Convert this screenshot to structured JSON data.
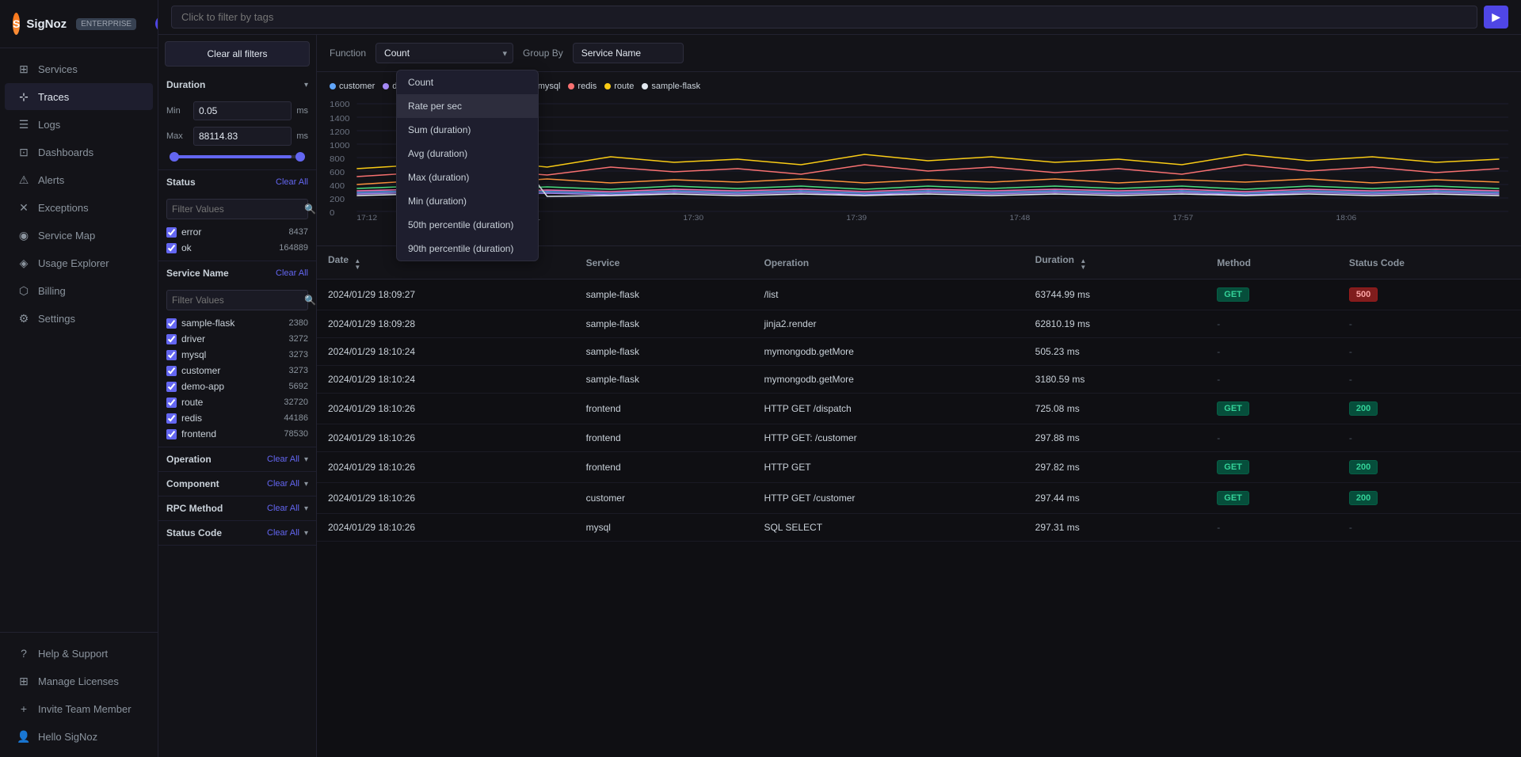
{
  "app": {
    "name": "SigNoz",
    "badge": "ENTERPRISE"
  },
  "topbar": {
    "placeholder": "Click to filter by tags"
  },
  "sidebar": {
    "items": [
      {
        "id": "services",
        "label": "Services",
        "icon": "⊞",
        "active": false
      },
      {
        "id": "traces",
        "label": "Traces",
        "icon": "⊹",
        "active": true
      },
      {
        "id": "logs",
        "label": "Logs",
        "icon": "☰",
        "active": false
      },
      {
        "id": "dashboards",
        "label": "Dashboards",
        "icon": "⊡",
        "active": false
      },
      {
        "id": "alerts",
        "label": "Alerts",
        "icon": "⚠",
        "active": false
      },
      {
        "id": "exceptions",
        "label": "Exceptions",
        "icon": "✕",
        "active": false
      },
      {
        "id": "service-map",
        "label": "Service Map",
        "icon": "◉",
        "active": false
      },
      {
        "id": "usage-explorer",
        "label": "Usage Explorer",
        "icon": "◈",
        "active": false
      },
      {
        "id": "billing",
        "label": "Billing",
        "icon": "⬡",
        "active": false
      },
      {
        "id": "settings",
        "label": "Settings",
        "icon": "⚙",
        "active": false
      }
    ],
    "bottom": [
      {
        "id": "help",
        "label": "Help & Support",
        "icon": "?"
      },
      {
        "id": "manage",
        "label": "Manage Licenses",
        "icon": "⊞"
      },
      {
        "id": "invite",
        "label": "Invite Team Member",
        "icon": "+"
      },
      {
        "id": "hello",
        "label": "Hello SigNoz",
        "icon": "👤"
      }
    ]
  },
  "filters": {
    "clear_all_label": "Clear all filters",
    "duration": {
      "title": "Duration",
      "min_label": "Min",
      "max_label": "Max",
      "min_value": "0.05",
      "max_value": "88114.83",
      "unit": "ms"
    },
    "status": {
      "title": "Status",
      "clear_label": "Clear All",
      "search_placeholder": "Filter Values",
      "items": [
        {
          "label": "error",
          "count": "8437",
          "checked": true
        },
        {
          "label": "ok",
          "count": "164889",
          "checked": true
        }
      ]
    },
    "service_name": {
      "title": "Service Name",
      "clear_label": "Clear All",
      "search_placeholder": "Filter Values",
      "items": [
        {
          "label": "sample-flask",
          "count": "2380",
          "checked": true
        },
        {
          "label": "driver",
          "count": "3272",
          "checked": true
        },
        {
          "label": "mysql",
          "count": "3273",
          "checked": true
        },
        {
          "label": "customer",
          "count": "3273",
          "checked": true
        },
        {
          "label": "demo-app",
          "count": "5692",
          "checked": true
        },
        {
          "label": "route",
          "count": "32720",
          "checked": true
        },
        {
          "label": "redis",
          "count": "44186",
          "checked": true
        },
        {
          "label": "frontend",
          "count": "78530",
          "checked": true
        }
      ]
    },
    "operation": {
      "title": "Operation",
      "clear_label": "Clear All"
    },
    "component": {
      "title": "Component",
      "clear_label": "Clear All"
    },
    "rpc_method": {
      "title": "RPC Method",
      "clear_label": "Clear All"
    },
    "status_code": {
      "title": "Status Code",
      "clear_label": "Clear All"
    }
  },
  "function_bar": {
    "function_label": "Function",
    "group_by_label": "Group By",
    "selected_function": "Count",
    "group_by_value": "Service Name",
    "dropdown_items": [
      "Count",
      "Rate per sec",
      "Sum (duration)",
      "Avg (duration)",
      "Max (duration)",
      "Min (duration)",
      "50th percentile (duration)",
      "90th percentile (duration)"
    ],
    "tooltip": "Rate per sec"
  },
  "chart": {
    "y_labels": [
      "1600",
      "1400",
      "1200",
      "1000",
      "800",
      "600",
      "400",
      "200",
      "0"
    ],
    "x_labels": [
      "17:12",
      "17:21",
      "17:30",
      "17:39",
      "17:48",
      "17:57",
      "18:06"
    ],
    "legend": [
      {
        "label": "customer",
        "color": "#60a5fa"
      },
      {
        "label": "demo-app",
        "color": "#a78bfa"
      },
      {
        "label": "driver",
        "color": "#f472b6"
      },
      {
        "label": "frontend",
        "color": "#fb923c"
      },
      {
        "label": "mysql",
        "color": "#4ade80"
      },
      {
        "label": "redis",
        "color": "#f87171"
      },
      {
        "label": "route",
        "color": "#facc15"
      },
      {
        "label": "sample-flask",
        "color": "#e2e8f0"
      }
    ]
  },
  "table": {
    "columns": [
      {
        "label": "Date",
        "sortable": true
      },
      {
        "label": "Service",
        "sortable": false
      },
      {
        "label": "Operation",
        "sortable": false
      },
      {
        "label": "Duration",
        "sortable": true
      },
      {
        "label": "Method",
        "sortable": false
      },
      {
        "label": "Status Code",
        "sortable": false
      }
    ],
    "rows": [
      {
        "date": "2024/01/29 18:09:27",
        "service": "sample-flask",
        "operation": "/list",
        "duration": "63744.99 ms",
        "method": "GET",
        "method_type": "badge-get",
        "status": "500",
        "status_type": "badge-500"
      },
      {
        "date": "2024/01/29 18:09:28",
        "service": "sample-flask",
        "operation": "jinja2.render",
        "duration": "62810.19 ms",
        "method": "-",
        "method_type": "dash",
        "status": "-",
        "status_type": "dash"
      },
      {
        "date": "2024/01/29 18:10:24",
        "service": "sample-flask",
        "operation": "mymongodb.getMore",
        "duration": "505.23 ms",
        "method": "-",
        "method_type": "dash",
        "status": "-",
        "status_type": "dash"
      },
      {
        "date": "2024/01/29 18:10:24",
        "service": "sample-flask",
        "operation": "mymongodb.getMore",
        "duration": "3180.59 ms",
        "method": "-",
        "method_type": "dash",
        "status": "-",
        "status_type": "dash"
      },
      {
        "date": "2024/01/29 18:10:26",
        "service": "frontend",
        "operation": "HTTP GET /dispatch",
        "duration": "725.08 ms",
        "method": "GET",
        "method_type": "badge-get",
        "status": "200",
        "status_type": "badge-200"
      },
      {
        "date": "2024/01/29 18:10:26",
        "service": "frontend",
        "operation": "HTTP GET: /customer",
        "duration": "297.88 ms",
        "method": "-",
        "method_type": "dash",
        "status": "-",
        "status_type": "dash"
      },
      {
        "date": "2024/01/29 18:10:26",
        "service": "frontend",
        "operation": "HTTP GET",
        "duration": "297.82 ms",
        "method": "GET",
        "method_type": "badge-get",
        "status": "200",
        "status_type": "badge-200"
      },
      {
        "date": "2024/01/29 18:10:26",
        "service": "customer",
        "operation": "HTTP GET /customer",
        "duration": "297.44 ms",
        "method": "GET",
        "method_type": "badge-get",
        "status": "200",
        "status_type": "badge-200"
      },
      {
        "date": "2024/01/29 18:10:26",
        "service": "mysql",
        "operation": "SQL SELECT",
        "duration": "297.31 ms",
        "method": "-",
        "method_type": "dash",
        "status": "-",
        "status_type": "dash"
      }
    ]
  }
}
